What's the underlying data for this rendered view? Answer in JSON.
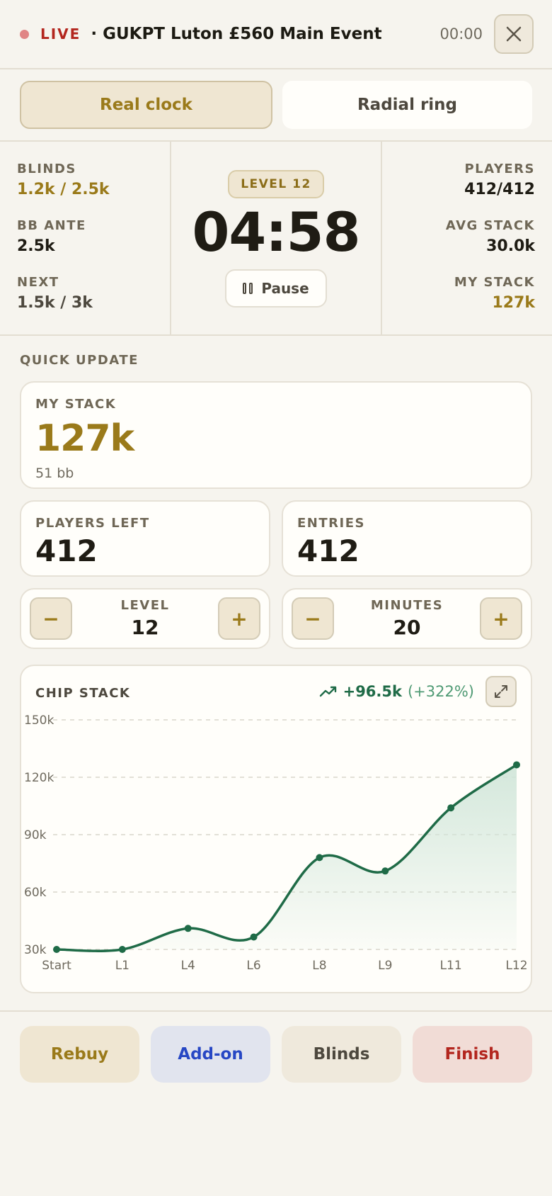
{
  "header": {
    "live_label": "LIVE",
    "event_title": "· GUKPT Luton £560 Main Event",
    "time": "00:00",
    "close_icon": "close-icon"
  },
  "modes": [
    {
      "label": "Real clock",
      "active": true
    },
    {
      "label": "Radial ring",
      "active": false
    }
  ],
  "stats": {
    "blinds_label": "BLINDS",
    "blinds_value": "1.2k / 2.5k",
    "bb_ante_label": "BB ANTE",
    "bb_ante_value": "2.5k",
    "next_label": "NEXT",
    "next_value": "1.5k / 3k",
    "level_badge": "LEVEL 12",
    "timer": "04:58",
    "pause_label": "Pause",
    "players_label": "PLAYERS",
    "players_value": "412/412",
    "avg_stack_label": "AVG STACK",
    "avg_stack_value": "30.0k",
    "my_stack_label": "MY STACK",
    "my_stack_value": "127k"
  },
  "quick_update": {
    "section_label": "QUICK UPDATE",
    "my_stack_label": "MY STACK",
    "my_stack_value": "127k",
    "my_stack_bb": "51 bb",
    "players_left_label": "PLAYERS LEFT",
    "players_left_value": "412",
    "entries_label": "ENTRIES",
    "entries_value": "412",
    "level_label": "LEVEL",
    "level_value": "12",
    "minutes_label": "MINUTES",
    "minutes_value": "20",
    "minus_symbol": "−",
    "plus_symbol": "+"
  },
  "chart_card": {
    "title": "CHIP STACK",
    "delta_value": "+96.5k",
    "delta_pct": "(+322%)",
    "colors": {
      "line": "#1f6b47",
      "fill": "#cfe5d8"
    }
  },
  "chart_data": {
    "type": "area",
    "x": [
      "Start",
      "L1",
      "L4",
      "L6",
      "L8",
      "L9",
      "L11",
      "L12"
    ],
    "y": [
      30,
      30,
      41,
      36.5,
      78,
      71,
      104,
      126.5
    ],
    "yticks": [
      "150k",
      "120k",
      "90k",
      "60k",
      "30k"
    ],
    "ylim": [
      30,
      150
    ],
    "grid": true
  },
  "actions": [
    {
      "label": "Rebuy",
      "bg": "#efe6d2",
      "color": "#9a7a1a"
    },
    {
      "label": "Add-on",
      "bg": "#e1e4ee",
      "color": "#2747c4"
    },
    {
      "label": "Blinds",
      "bg": "#efe9dc",
      "color": "#4d483e"
    },
    {
      "label": "Finish",
      "bg": "#f1dcd6",
      "color": "#b3261e"
    }
  ]
}
